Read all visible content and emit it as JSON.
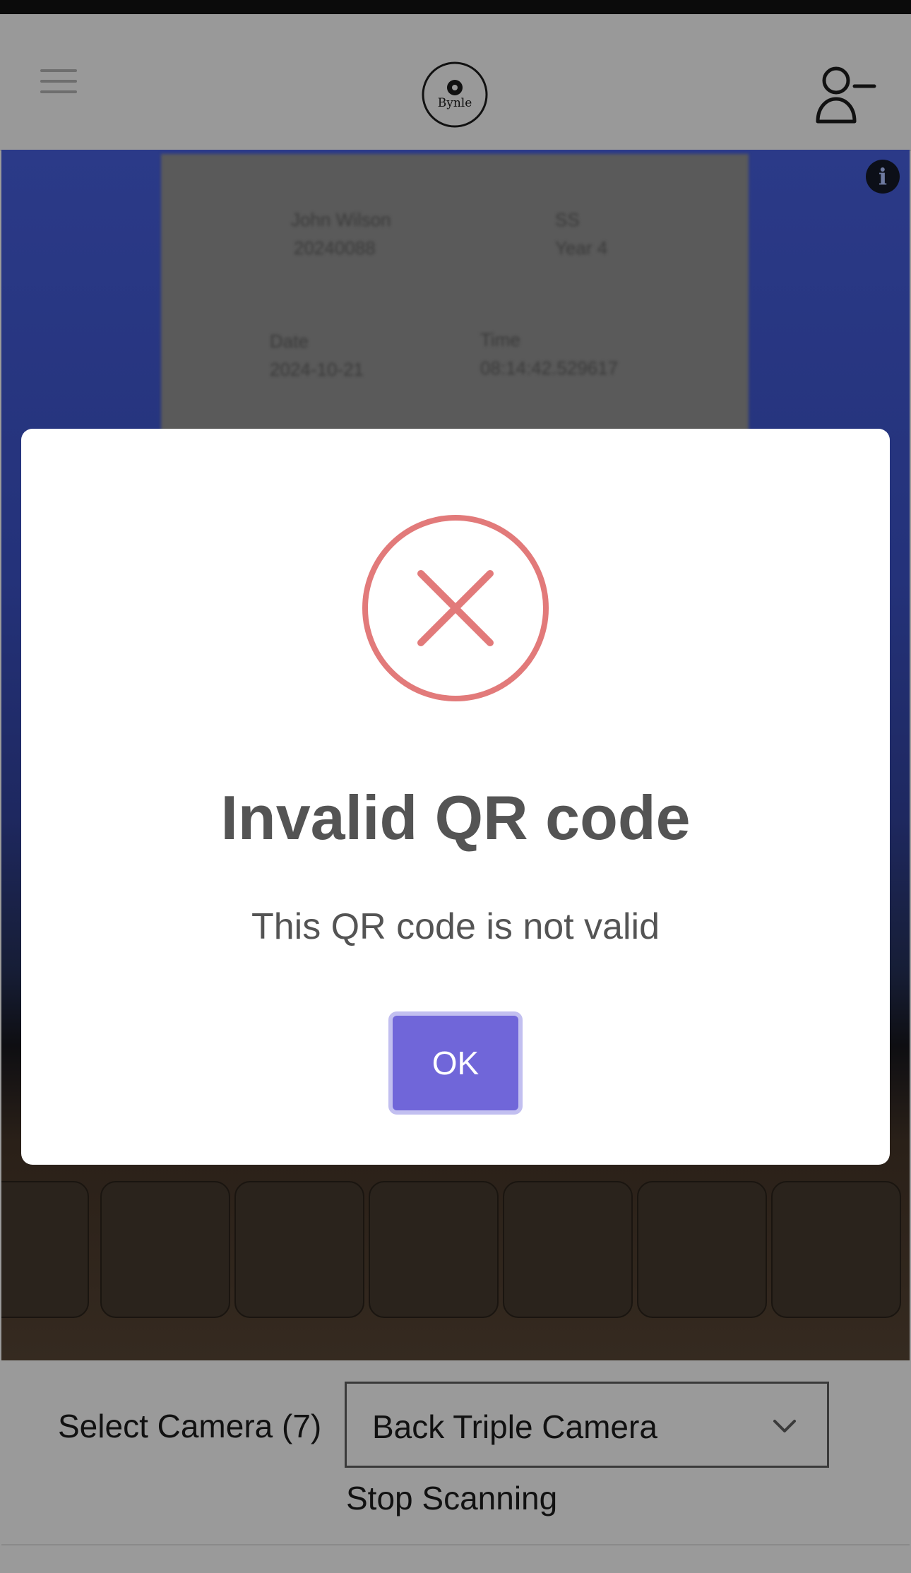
{
  "header": {
    "logo_text": "Bynle",
    "menu_icon": "hamburger-menu-icon",
    "account_icon": "user-minus-icon"
  },
  "camera_view": {
    "info_icon": "info-icon",
    "paper": {
      "name": "John Wilson",
      "id": "20240088",
      "code": "SS",
      "year": "Year 4",
      "date_label": "Date",
      "date": "2024-10-21",
      "time_label": "Time",
      "time": "08:14:42.529617"
    }
  },
  "controls": {
    "select_camera_label": "Select Camera (7)",
    "selected_camera": "Back Triple Camera",
    "stop_label": "Stop Scanning"
  },
  "modal": {
    "icon": "error-x-icon",
    "title": "Invalid QR code",
    "message": "This QR code is not valid",
    "ok_label": "OK"
  },
  "colors": {
    "error_red": "#e27a7a",
    "button_purple": "#7066d9",
    "button_ring": "#c2bff0",
    "text_gray": "#545454",
    "page_bg": "#9a9a9a"
  }
}
